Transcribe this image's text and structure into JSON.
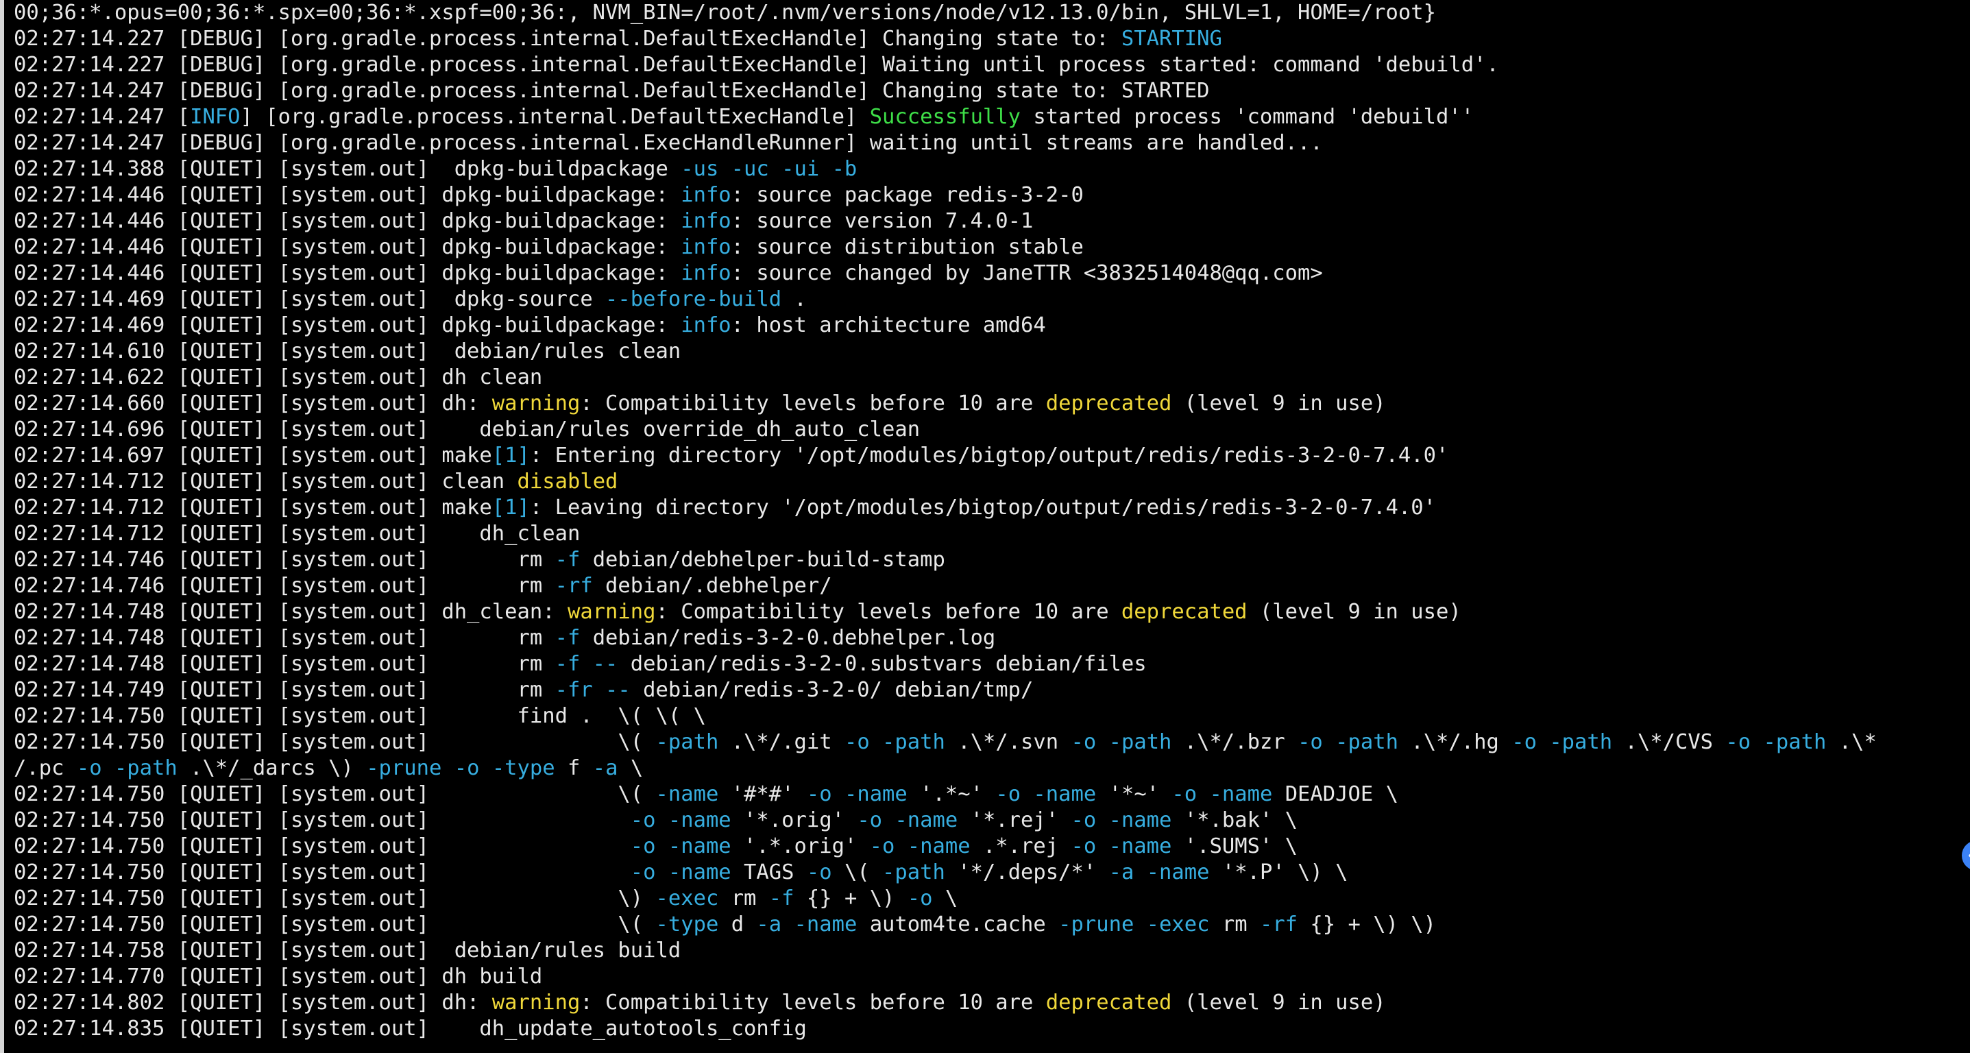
{
  "colors": {
    "background": "#000000",
    "text": "#e8e8e8",
    "keyword": "#37aee0",
    "warning": "#f0d83a",
    "success": "#3ede48",
    "handle": "#3b82f6"
  },
  "side_handle": {
    "icon": "chevron-left-icon"
  },
  "lines": [
    [
      {
        "t": "00;36:*.opus=00;36:*.spx=00;36:*.xspf=00;36:, NVM_BIN=/root/.nvm/versions/node/v12.13.0/bin, SHLVL=1, HOME=/root}",
        "c": "white"
      }
    ],
    [
      {
        "t": "02:27:14.227 [DEBUG] [org.gradle.process.internal.DefaultExecHandle] Changing state to: ",
        "c": "white"
      },
      {
        "t": "STARTING",
        "c": "blue"
      }
    ],
    [
      {
        "t": "02:27:14.227 [DEBUG] [org.gradle.process.internal.DefaultExecHandle] Waiting until process started: command 'debuild'.",
        "c": "white"
      }
    ],
    [
      {
        "t": "02:27:14.247 [DEBUG] [org.gradle.process.internal.DefaultExecHandle] Changing state to: STARTED",
        "c": "white"
      }
    ],
    [
      {
        "t": "02:27:14.247 [",
        "c": "white"
      },
      {
        "t": "INFO",
        "c": "blue"
      },
      {
        "t": "] [org.gradle.process.internal.DefaultExecHandle] ",
        "c": "white"
      },
      {
        "t": "Successfully",
        "c": "green"
      },
      {
        "t": " started process 'command 'debuild''",
        "c": "white"
      }
    ],
    [
      {
        "t": "02:27:14.247 [DEBUG] [org.gradle.process.internal.ExecHandleRunner] waiting until streams are handled...",
        "c": "white"
      }
    ],
    [
      {
        "t": "02:27:14.388 [QUIET] [system.out]  dpkg-buildpackage ",
        "c": "white"
      },
      {
        "t": "-us -uc -ui -b",
        "c": "blue"
      }
    ],
    [
      {
        "t": "02:27:14.446 [QUIET] [system.out] dpkg-buildpackage: ",
        "c": "white"
      },
      {
        "t": "info",
        "c": "blue"
      },
      {
        "t": ": source package redis-3-2-0",
        "c": "white"
      }
    ],
    [
      {
        "t": "02:27:14.446 [QUIET] [system.out] dpkg-buildpackage: ",
        "c": "white"
      },
      {
        "t": "info",
        "c": "blue"
      },
      {
        "t": ": source version 7.4.0-1",
        "c": "white"
      }
    ],
    [
      {
        "t": "02:27:14.446 [QUIET] [system.out] dpkg-buildpackage: ",
        "c": "white"
      },
      {
        "t": "info",
        "c": "blue"
      },
      {
        "t": ": source distribution stable",
        "c": "white"
      }
    ],
    [
      {
        "t": "02:27:14.446 [QUIET] [system.out] dpkg-buildpackage: ",
        "c": "white"
      },
      {
        "t": "info",
        "c": "blue"
      },
      {
        "t": ": source changed by JaneTTR <3832514048@qq.com>",
        "c": "white"
      }
    ],
    [
      {
        "t": "02:27:14.469 [QUIET] [system.out]  dpkg-source ",
        "c": "white"
      },
      {
        "t": "--before-build",
        "c": "blue"
      },
      {
        "t": " .",
        "c": "white"
      }
    ],
    [
      {
        "t": "02:27:14.469 [QUIET] [system.out] dpkg-buildpackage: ",
        "c": "white"
      },
      {
        "t": "info",
        "c": "blue"
      },
      {
        "t": ": host architecture amd64",
        "c": "white"
      }
    ],
    [
      {
        "t": "02:27:14.610 [QUIET] [system.out]  debian/rules clean",
        "c": "white"
      }
    ],
    [
      {
        "t": "02:27:14.622 [QUIET] [system.out] dh clean",
        "c": "white"
      }
    ],
    [
      {
        "t": "02:27:14.660 [QUIET] [system.out] dh: ",
        "c": "white"
      },
      {
        "t": "warning",
        "c": "yellow"
      },
      {
        "t": ": Compatibility levels before 10 are ",
        "c": "white"
      },
      {
        "t": "deprecated",
        "c": "yellow"
      },
      {
        "t": " (level 9 in use)",
        "c": "white"
      }
    ],
    [
      {
        "t": "02:27:14.696 [QUIET] [system.out]    debian/rules override_dh_auto_clean",
        "c": "white"
      }
    ],
    [
      {
        "t": "02:27:14.697 [QUIET] [system.out] make",
        "c": "white"
      },
      {
        "t": "[1]",
        "c": "blue"
      },
      {
        "t": ": Entering directory '/opt/modules/bigtop/output/redis/redis-3-2-0-7.4.0'",
        "c": "white"
      }
    ],
    [
      {
        "t": "02:27:14.712 [QUIET] [system.out] clean ",
        "c": "white"
      },
      {
        "t": "disabled",
        "c": "yellow"
      }
    ],
    [
      {
        "t": "02:27:14.712 [QUIET] [system.out] make",
        "c": "white"
      },
      {
        "t": "[1]",
        "c": "blue"
      },
      {
        "t": ": Leaving directory '/opt/modules/bigtop/output/redis/redis-3-2-0-7.4.0'",
        "c": "white"
      }
    ],
    [
      {
        "t": "02:27:14.712 [QUIET] [system.out]    dh_clean",
        "c": "white"
      }
    ],
    [
      {
        "t": "02:27:14.746 [QUIET] [system.out]       rm ",
        "c": "white"
      },
      {
        "t": "-f",
        "c": "blue"
      },
      {
        "t": " debian/debhelper-build-stamp",
        "c": "white"
      }
    ],
    [
      {
        "t": "02:27:14.746 [QUIET] [system.out]       rm ",
        "c": "white"
      },
      {
        "t": "-rf",
        "c": "blue"
      },
      {
        "t": " debian/.debhelper/",
        "c": "white"
      }
    ],
    [
      {
        "t": "02:27:14.748 [QUIET] [system.out] dh_clean: ",
        "c": "white"
      },
      {
        "t": "warning",
        "c": "yellow"
      },
      {
        "t": ": Compatibility levels before 10 are ",
        "c": "white"
      },
      {
        "t": "deprecated",
        "c": "yellow"
      },
      {
        "t": " (level 9 in use)",
        "c": "white"
      }
    ],
    [
      {
        "t": "02:27:14.748 [QUIET] [system.out]       rm ",
        "c": "white"
      },
      {
        "t": "-f",
        "c": "blue"
      },
      {
        "t": " debian/redis-3-2-0.debhelper.log",
        "c": "white"
      }
    ],
    [
      {
        "t": "02:27:14.748 [QUIET] [system.out]       rm ",
        "c": "white"
      },
      {
        "t": "-f --",
        "c": "blue"
      },
      {
        "t": " debian/redis-3-2-0.substvars debian/files",
        "c": "white"
      }
    ],
    [
      {
        "t": "02:27:14.749 [QUIET] [system.out]       rm ",
        "c": "white"
      },
      {
        "t": "-fr --",
        "c": "blue"
      },
      {
        "t": " debian/redis-3-2-0/ debian/tmp/",
        "c": "white"
      }
    ],
    [
      {
        "t": "02:27:14.750 [QUIET] [system.out]       find .  \\( \\( \\",
        "c": "white"
      }
    ],
    [
      {
        "t": "02:27:14.750 [QUIET] [system.out]               \\( ",
        "c": "white"
      },
      {
        "t": "-path",
        "c": "blue"
      },
      {
        "t": " .\\*/.git ",
        "c": "white"
      },
      {
        "t": "-o -path",
        "c": "blue"
      },
      {
        "t": " .\\*/.svn ",
        "c": "white"
      },
      {
        "t": "-o -path",
        "c": "blue"
      },
      {
        "t": " .\\*/.bzr ",
        "c": "white"
      },
      {
        "t": "-o -path",
        "c": "blue"
      },
      {
        "t": " .\\*/.hg ",
        "c": "white"
      },
      {
        "t": "-o -path",
        "c": "blue"
      },
      {
        "t": " .\\*/CVS ",
        "c": "white"
      },
      {
        "t": "-o -path",
        "c": "blue"
      },
      {
        "t": " .\\*",
        "c": "white"
      }
    ],
    [
      {
        "t": "/.pc ",
        "c": "white"
      },
      {
        "t": "-o -path",
        "c": "blue"
      },
      {
        "t": " .\\*/_darcs \\) ",
        "c": "white"
      },
      {
        "t": "-prune -o -type",
        "c": "blue"
      },
      {
        "t": " f ",
        "c": "white"
      },
      {
        "t": "-a",
        "c": "blue"
      },
      {
        "t": " \\",
        "c": "white"
      }
    ],
    [
      {
        "t": "02:27:14.750 [QUIET] [system.out]               \\( ",
        "c": "white"
      },
      {
        "t": "-name",
        "c": "blue"
      },
      {
        "t": " '#*#' ",
        "c": "white"
      },
      {
        "t": "-o -name",
        "c": "blue"
      },
      {
        "t": " '.*~' ",
        "c": "white"
      },
      {
        "t": "-o -name",
        "c": "blue"
      },
      {
        "t": " '*~' ",
        "c": "white"
      },
      {
        "t": "-o -name",
        "c": "blue"
      },
      {
        "t": " DEADJOE \\",
        "c": "white"
      }
    ],
    [
      {
        "t": "02:27:14.750 [QUIET] [system.out]                ",
        "c": "white"
      },
      {
        "t": "-o -name",
        "c": "blue"
      },
      {
        "t": " '*.orig' ",
        "c": "white"
      },
      {
        "t": "-o -name",
        "c": "blue"
      },
      {
        "t": " '*.rej' ",
        "c": "white"
      },
      {
        "t": "-o -name",
        "c": "blue"
      },
      {
        "t": " '*.bak' \\",
        "c": "white"
      }
    ],
    [
      {
        "t": "02:27:14.750 [QUIET] [system.out]                ",
        "c": "white"
      },
      {
        "t": "-o -name",
        "c": "blue"
      },
      {
        "t": " '.*.orig' ",
        "c": "white"
      },
      {
        "t": "-o -name",
        "c": "blue"
      },
      {
        "t": " .*.rej ",
        "c": "white"
      },
      {
        "t": "-o -name",
        "c": "blue"
      },
      {
        "t": " '.SUMS' \\",
        "c": "white"
      }
    ],
    [
      {
        "t": "02:27:14.750 [QUIET] [system.out]                ",
        "c": "white"
      },
      {
        "t": "-o -name",
        "c": "blue"
      },
      {
        "t": " TAGS ",
        "c": "white"
      },
      {
        "t": "-o",
        "c": "blue"
      },
      {
        "t": " \\( ",
        "c": "white"
      },
      {
        "t": "-path",
        "c": "blue"
      },
      {
        "t": " '*/.deps/*' ",
        "c": "white"
      },
      {
        "t": "-a -name",
        "c": "blue"
      },
      {
        "t": " '*.P' \\) \\",
        "c": "white"
      }
    ],
    [
      {
        "t": "02:27:14.750 [QUIET] [system.out]               \\) ",
        "c": "white"
      },
      {
        "t": "-exec",
        "c": "blue"
      },
      {
        "t": " rm ",
        "c": "white"
      },
      {
        "t": "-f",
        "c": "blue"
      },
      {
        "t": " {} + \\) ",
        "c": "white"
      },
      {
        "t": "-o",
        "c": "blue"
      },
      {
        "t": " \\",
        "c": "white"
      }
    ],
    [
      {
        "t": "02:27:14.750 [QUIET] [system.out]               \\( ",
        "c": "white"
      },
      {
        "t": "-type",
        "c": "blue"
      },
      {
        "t": " d ",
        "c": "white"
      },
      {
        "t": "-a -name",
        "c": "blue"
      },
      {
        "t": " autom4te.cache ",
        "c": "white"
      },
      {
        "t": "-prune -exec",
        "c": "blue"
      },
      {
        "t": " rm ",
        "c": "white"
      },
      {
        "t": "-rf",
        "c": "blue"
      },
      {
        "t": " {} + \\) \\)",
        "c": "white"
      }
    ],
    [
      {
        "t": "02:27:14.758 [QUIET] [system.out]  debian/rules build",
        "c": "white"
      }
    ],
    [
      {
        "t": "02:27:14.770 [QUIET] [system.out] dh build",
        "c": "white"
      }
    ],
    [
      {
        "t": "02:27:14.802 [QUIET] [system.out] dh: ",
        "c": "white"
      },
      {
        "t": "warning",
        "c": "yellow"
      },
      {
        "t": ": Compatibility levels before 10 are ",
        "c": "white"
      },
      {
        "t": "deprecated",
        "c": "yellow"
      },
      {
        "t": " (level 9 in use)",
        "c": "white"
      }
    ],
    [
      {
        "t": "02:27:14.835 [QUIET] [system.out]    dh_update_autotools_config",
        "c": "white"
      }
    ]
  ]
}
